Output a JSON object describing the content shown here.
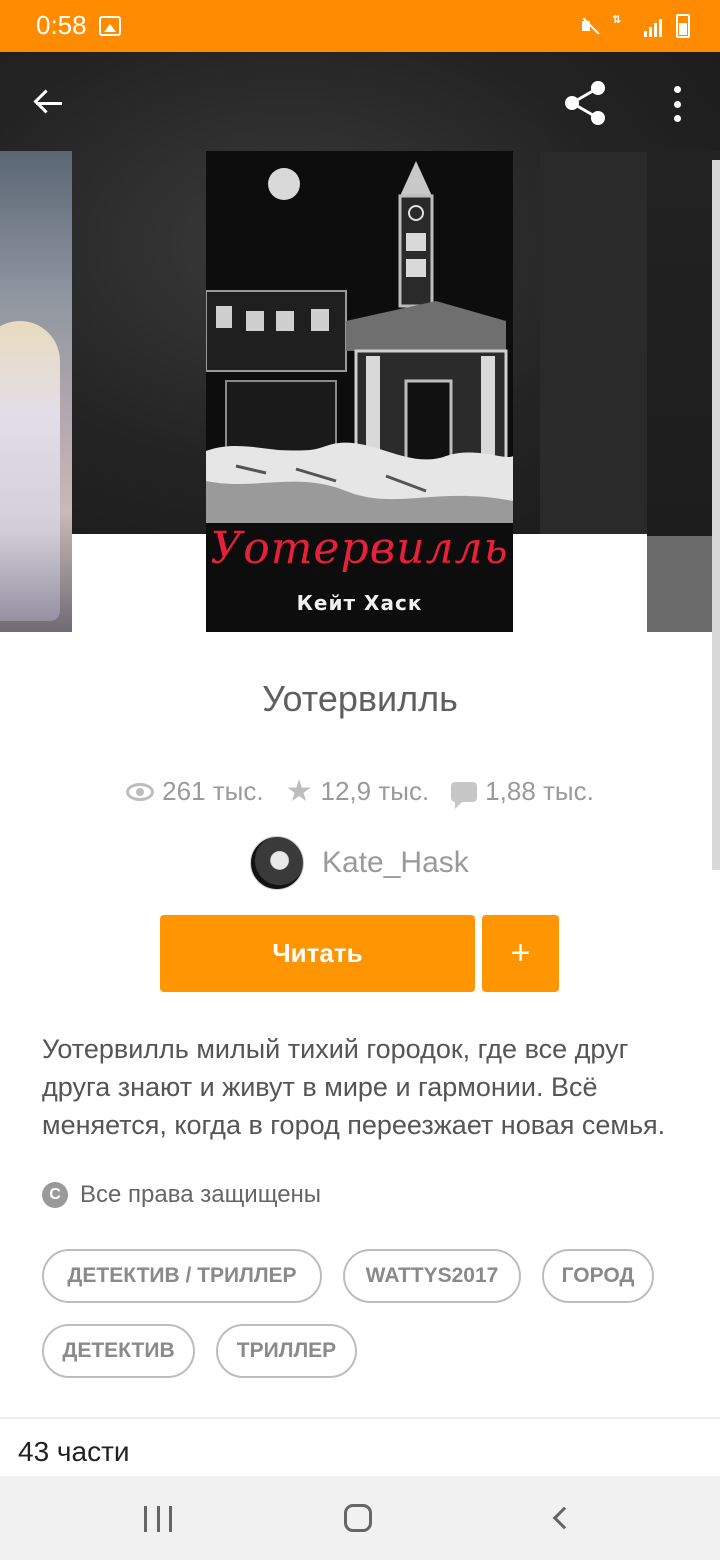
{
  "status_bar": {
    "time": "0:58",
    "icons": [
      "image-icon",
      "mute-icon",
      "data-icon",
      "signal-icon",
      "battery-icon"
    ]
  },
  "top_bar": {
    "icons": [
      "back-arrow-icon",
      "share-icon",
      "more-vert-icon"
    ]
  },
  "cover": {
    "title": "Уотервилль",
    "author": "Кейт Хаск"
  },
  "book": {
    "title": "Уотервилль",
    "stats": {
      "reads": "261 тыс.",
      "votes": "12,9 тыс.",
      "comments": "1,88 тыс."
    },
    "author": "Kate_Hask",
    "read_button": "Читать",
    "add_button": "+",
    "description": "Уотервилль милый тихий городок, где все друг друга знают и живут в мире и гармонии. Всё меняется, когда в город переезжает новая семья.",
    "copyright_symbol": "C",
    "copyright": "Все права защищены",
    "tags": [
      "ДЕТЕКТИВ / ТРИЛЛЕР",
      "WATTYS2017",
      "ГОРОД",
      "ДЕТЕКТИВ",
      "ТРИЛЛЕР"
    ],
    "parts": "43 части"
  },
  "colors": {
    "accent": "#ff9500",
    "status_bar": "#ff8c00",
    "cover_title": "#e8203a"
  }
}
